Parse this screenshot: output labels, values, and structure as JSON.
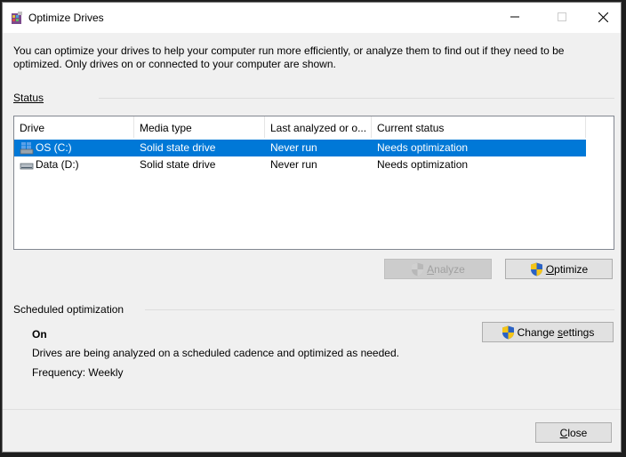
{
  "window": {
    "title": "Optimize Drives",
    "intro_text": "You can optimize your drives to help your computer run more efficiently, or analyze them to find out if they need to be optimized. Only drives on or connected to your computer are shown."
  },
  "status": {
    "label": "Status",
    "columns": [
      "Drive",
      "Media type",
      "Last analyzed or o...",
      "Current status"
    ],
    "drives": [
      {
        "name": "OS (C:)",
        "media_type": "Solid state drive",
        "last_analyzed": "Never run",
        "status": "Needs optimization",
        "selected": true
      },
      {
        "name": "Data (D:)",
        "media_type": "Solid state drive",
        "last_analyzed": "Never run",
        "status": "Needs optimization",
        "selected": false
      }
    ],
    "analyze_button": {
      "access_key": "A",
      "rest": "nalyze"
    },
    "optimize_button": {
      "access_key": "O",
      "rest": "ptimize"
    }
  },
  "scheduled": {
    "label": "Scheduled optimization",
    "state": "On",
    "description": "Drives are being analyzed on a scheduled cadence and optimized as needed.",
    "frequency": "Frequency: Weekly",
    "change_settings_button": {
      "before": "Change ",
      "access_key": "s",
      "after": "ettings"
    }
  },
  "footer": {
    "close_button": {
      "access_key": "C",
      "rest": "lose"
    }
  },
  "colors": {
    "selection": "#0078d7",
    "window_bg": "#f0f0f0",
    "titlebar_bg": "#ffffff"
  }
}
